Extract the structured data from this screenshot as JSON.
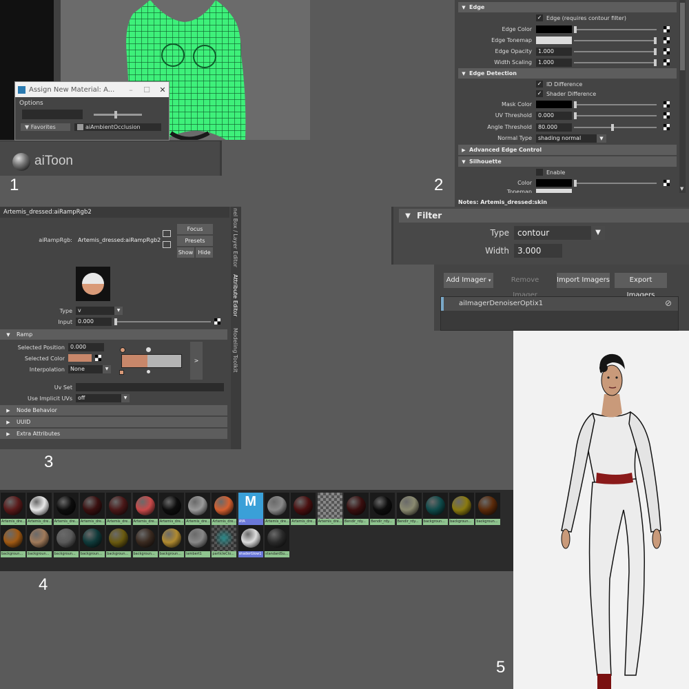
{
  "panel1": {
    "dialog_title": "Assign New Material: A...",
    "options_menu": "Options",
    "favorites_label": "Favorites",
    "list_item": "aiAmbientOcclusion",
    "material_name": "aiToon"
  },
  "step_numbers": [
    "1",
    "2",
    "3",
    "4",
    "5"
  ],
  "panel2": {
    "edge_header": "Edge",
    "edge_checkbox": "Edge (requires contour filter)",
    "edge_color_label": "Edge Color",
    "edge_tonemap_label": "Edge Tonemap",
    "edge_opacity_label": "Edge Opacity",
    "edge_opacity_value": "1.000",
    "width_scaling_label": "Width Scaling",
    "width_scaling_value": "1.000",
    "edge_detection_header": "Edge Detection",
    "id_difference": "ID Difference",
    "shader_difference": "Shader Difference",
    "mask_color_label": "Mask Color",
    "uv_threshold_label": "UV Threshold",
    "uv_threshold_value": "0.000",
    "angle_threshold_label": "Angle Threshold",
    "angle_threshold_value": "80.000",
    "normal_type_label": "Normal Type",
    "normal_type_value": "shading normal",
    "advanced_header": "Advanced Edge Control",
    "silhouette_header": "Silhouette",
    "enable_label": "Enable",
    "color_label": "Color",
    "tonemap_label": "Tonemap",
    "notes": "Notes:  Artemis_dressed:skin"
  },
  "filter": {
    "header": "Filter",
    "type_label": "Type",
    "type_value": "contour",
    "width_label": "Width",
    "width_value": "3.000"
  },
  "imager": {
    "add_imager": "Add Imager",
    "remove_imager": "Remove Imager",
    "import_imagers": "Import Imagers",
    "export_imagers": "Export Imagers",
    "item": "aiImagerDenoiserOptix1"
  },
  "panel3": {
    "tab_title": "Artemis_dressed:aiRampRgb2",
    "node_label": "aiRampRgb:",
    "node_value": "Artemis_dressed:aiRampRgb2",
    "focus": "Focus",
    "presets": "Presets",
    "show": "Show",
    "hide": "Hide",
    "type_label": "Type",
    "type_value": "v",
    "input_label": "Input",
    "input_value": "0.000",
    "ramp_header": "Ramp",
    "selected_position_label": "Selected Position",
    "selected_position_value": "0.000",
    "selected_color_label": "Selected Color",
    "interpolation_label": "Interpolation",
    "interpolation_value": "None",
    "uv_set_label": "Uv Set",
    "use_implicit_uvs_label": "Use Implicit UVs",
    "use_implicit_uvs_value": "off",
    "node_behavior": "Node Behavior",
    "uuid": "UUID",
    "extra_attributes": "Extra Attributes",
    "side_tabs": [
      "nel Box / Layer Editor",
      "Attribute Editor",
      "Modeling Toolkit"
    ],
    "ramp_color": "#c8876a",
    "ramp_gray": "#b4b4b4"
  },
  "hypershade": {
    "row1": [
      {
        "label": "Artemis_dre...",
        "color": "#5a1a1a"
      },
      {
        "label": "Artemis_dre...",
        "color": "#e8e8e8"
      },
      {
        "label": "Artemis_dre...",
        "color": "#0d0d0d"
      },
      {
        "label": "Artemis_dre...",
        "color": "#3a1010"
      },
      {
        "label": "Artemis_dre...",
        "color": "#4a1818"
      },
      {
        "label": "Artemis_dre...",
        "color": "#c84a4a"
      },
      {
        "label": "Artemis_dre...",
        "color": "#0d0d0d"
      },
      {
        "label": "Artemis_dre...",
        "color": "#9a9a9a"
      },
      {
        "label": "Artemis_dre...",
        "color": "#d46030"
      },
      {
        "label": "AYA",
        "color": "#3aa0d8"
      },
      {
        "label": "Artemis_dre...",
        "color": "#8a8a8a"
      },
      {
        "label": "Artemis_dre...",
        "color": "#4a1010"
      },
      {
        "label": "Artemis_dre...",
        "color": "checker"
      },
      {
        "label": "Bendir_rdy...",
        "color": "#3a0f0f"
      },
      {
        "label": "Bendir_rdy...",
        "color": "#0d0d0d"
      },
      {
        "label": "Bendir_rdy...",
        "color": "#8a8a70"
      },
      {
        "label": "backgroun...",
        "color": "#0f4a4a"
      },
      {
        "label": "backgroun...",
        "color": "#8a7a10"
      },
      {
        "label": "backgroun...",
        "color": "#5a2a0a"
      }
    ],
    "row2": [
      {
        "label": "backgroun...",
        "color": "#a05a14"
      },
      {
        "label": "backgroun...",
        "color": "#a07a5a"
      },
      {
        "label": "backgroun...",
        "color": "#5a5a5a"
      },
      {
        "label": "backgroun...",
        "color": "#0f3a3a"
      },
      {
        "label": "backgroun...",
        "color": "#6a5a10"
      },
      {
        "label": "backgroun...",
        "color": "#3a2a20"
      },
      {
        "label": "backgroun...",
        "color": "#b08a30"
      },
      {
        "label": "lambert1",
        "color": "#888888"
      },
      {
        "label": "particleClo...",
        "color": "checker-teal"
      },
      {
        "label": "shaderGlow1",
        "color": "#dddddd"
      },
      {
        "label": "standardSu...",
        "color": "#2a2a2a"
      }
    ],
    "aya_logo": "M"
  }
}
